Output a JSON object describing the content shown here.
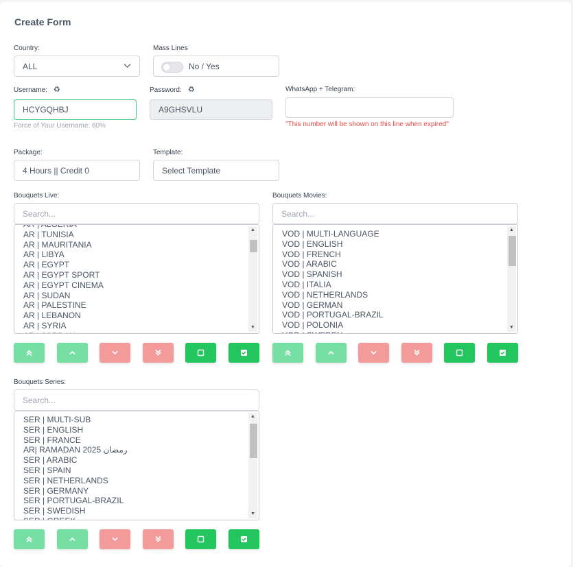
{
  "form_title": "Create Form",
  "country": {
    "label": "Country:",
    "value": "ALL"
  },
  "mass_lines": {
    "label": "Mass Lines",
    "toggle_text": "No / Yes",
    "enabled": false
  },
  "username": {
    "label": "Username:",
    "value": "HCYGQHBJ",
    "strength_text": "Force of Your Username: 60%"
  },
  "password": {
    "label": "Password:",
    "value": "A9GHSVLU"
  },
  "contact": {
    "label": "WhatsApp + Telegram:",
    "value": "",
    "note": "\"This number will be shown on this line when expired\""
  },
  "package": {
    "label": "Package:",
    "value": "4 Hours || Credit 0"
  },
  "template": {
    "label": "Template:",
    "value": "Select Template"
  },
  "bouquets_live": {
    "label": "Bouquets Live:",
    "search_placeholder": "Search...",
    "items": [
      "AR | ALGERIA",
      "AR | TUNISIA",
      "AR | MAURITANIA",
      "AR | LIBYA",
      "AR | EGYPT",
      "AR | EGYPT SPORT",
      "AR | EGYPT CINEMA",
      "AR | SUDAN",
      "AR | PALESTINE",
      "AR | LEBANON",
      "AR | SYRIA",
      "AR | JORDAN"
    ]
  },
  "bouquets_movies": {
    "label": "Bouquets Movies:",
    "search_placeholder": "Search...",
    "items": [
      "VOD | MULTI-LANGUAGE",
      "VOD | ENGLISH",
      "VOD | FRENCH",
      "VOD | ARABIC",
      "VOD | SPANISH",
      "VOD | ITALIA",
      "VOD | NETHERLANDS",
      "VOD | GERMAN",
      "VOD | PORTUGAL-BRAZIL",
      "VOD | POLONIA",
      "VOD | SWEDEN"
    ]
  },
  "bouquets_series": {
    "label": "Bouquets Series:",
    "search_placeholder": "Search...",
    "items": [
      "SER | MULTI-SUB",
      "SER | ENGLISH",
      "SER | FRANCE",
      "AR| RAMADAN 2025 رمضان",
      "SER | ARABIC",
      "SER | SPAIN",
      "SER | NETHERLANDS",
      "SER | GERMANY",
      "SER | PORTUGAL-BRAZIL",
      "SER | SWEDISH",
      "SER | GREEK"
    ]
  },
  "action_buttons": [
    "move-top",
    "move-up",
    "move-down",
    "move-bottom",
    "deselect-all",
    "select-all"
  ],
  "colors": {
    "accent_green": "#22c55e",
    "light_green": "#76e0a4",
    "light_red": "#f39a9a",
    "error_red": "#ef4444"
  }
}
